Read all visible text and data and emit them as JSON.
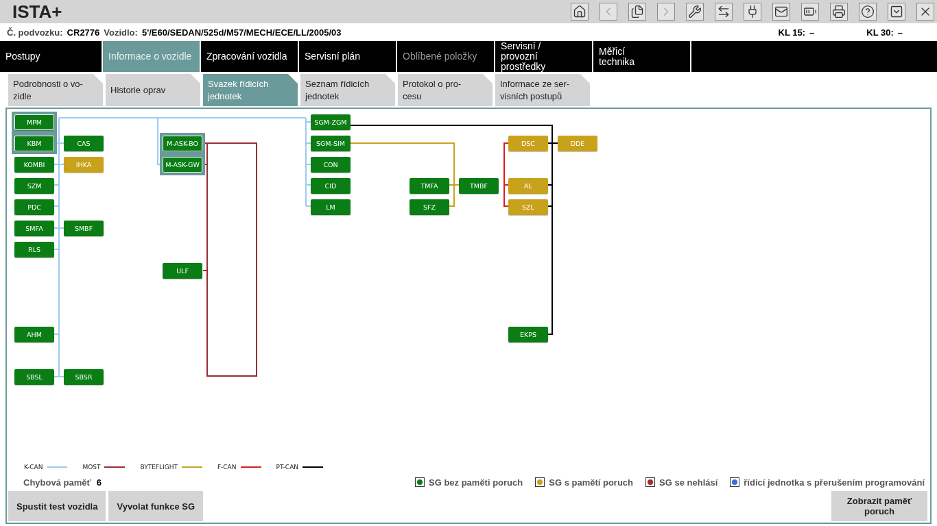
{
  "app": {
    "title": "ISTA+"
  },
  "toolbar": [
    {
      "kind": "home",
      "disabled": false
    },
    {
      "kind": "back",
      "disabled": true
    },
    {
      "kind": "documents",
      "disabled": false
    },
    {
      "kind": "forward",
      "disabled": true
    },
    {
      "kind": "wrench",
      "disabled": false
    },
    {
      "kind": "exchange",
      "disabled": false
    },
    {
      "kind": "plug",
      "disabled": false
    },
    {
      "kind": "mail",
      "disabled": false
    },
    {
      "kind": "battery",
      "disabled": false
    },
    {
      "kind": "printer",
      "disabled": false
    },
    {
      "kind": "help",
      "disabled": false
    },
    {
      "kind": "dropdown",
      "disabled": false
    },
    {
      "kind": "close",
      "disabled": false
    }
  ],
  "vehicle_info": {
    "chassis_label": "Č. podvozku:",
    "chassis_value": "CR2776",
    "vehicle_label": "Vozidlo:",
    "vehicle_value": "5'/E60/SEDAN/525d/M57/MECH/ECE/LL/2005/03",
    "kl15_label": "KL 15:",
    "kl15_value": "–",
    "kl30_label": "KL 30:",
    "kl30_value": "–"
  },
  "nav_tabs": [
    {
      "label": "Postupy",
      "selected": false,
      "disabled": false
    },
    {
      "label": "Informace o vozidle",
      "selected": true,
      "disabled": false
    },
    {
      "label": "Zpracování vozidla",
      "selected": false,
      "disabled": false
    },
    {
      "label": "Servisní plán",
      "selected": false,
      "disabled": false
    },
    {
      "label": "Oblíbené položky",
      "selected": false,
      "disabled": true
    },
    {
      "label": "Servisní /\nprovozní\nprostředky",
      "selected": false,
      "disabled": false
    },
    {
      "label": "Měřicí\ntechnika",
      "selected": false,
      "disabled": false
    }
  ],
  "sub_tabs": [
    {
      "label": "Podrobnosti o vo-\nzidle",
      "selected": false
    },
    {
      "label": "Historie oprav",
      "selected": false
    },
    {
      "label": "Svazek řídicích jednotek",
      "selected": true
    },
    {
      "label": "Seznam řídicích jednotek",
      "selected": false
    },
    {
      "label": "Protokol o pro-\ncesu",
      "selected": false
    },
    {
      "label": "Informace ze ser-\nvisních postupů",
      "selected": false
    }
  ],
  "control_units": [
    {
      "label": "MPM",
      "kind": "ok",
      "highlighted": true
    },
    {
      "label": "KBM",
      "kind": "ok",
      "highlighted": true
    },
    {
      "label": "CAS",
      "kind": "ok",
      "highlighted": false
    },
    {
      "label": "KOMBI",
      "kind": "ok",
      "highlighted": false
    },
    {
      "label": "IHKA",
      "kind": "fault",
      "highlighted": false
    },
    {
      "label": "SZM",
      "kind": "ok",
      "highlighted": false
    },
    {
      "label": "PDC",
      "kind": "ok",
      "highlighted": false
    },
    {
      "label": "SMFA",
      "kind": "ok",
      "highlighted": false
    },
    {
      "label": "SMBF",
      "kind": "ok",
      "highlighted": false
    },
    {
      "label": "RLS",
      "kind": "ok",
      "highlighted": false
    },
    {
      "label": "AHM",
      "kind": "ok",
      "highlighted": false
    },
    {
      "label": "SBSL",
      "kind": "ok",
      "highlighted": false
    },
    {
      "label": "SBSR",
      "kind": "ok",
      "highlighted": false
    },
    {
      "label": "M-ASK-BO",
      "kind": "ok",
      "highlighted": true
    },
    {
      "label": "M-ASK-GW",
      "kind": "ok",
      "highlighted": true
    },
    {
      "label": "ULF",
      "kind": "ok",
      "highlighted": false
    },
    {
      "label": "SGM-ZGM",
      "kind": "ok",
      "highlighted": false
    },
    {
      "label": "SGM-SIM",
      "kind": "ok",
      "highlighted": false
    },
    {
      "label": "CON",
      "kind": "ok",
      "highlighted": false
    },
    {
      "label": "CID",
      "kind": "ok",
      "highlighted": false
    },
    {
      "label": "LM",
      "kind": "ok",
      "highlighted": false
    },
    {
      "label": "TMFA",
      "kind": "ok",
      "highlighted": false
    },
    {
      "label": "SFZ",
      "kind": "ok",
      "highlighted": false
    },
    {
      "label": "TMBF",
      "kind": "ok",
      "highlighted": false
    },
    {
      "label": "DSC",
      "kind": "fault",
      "highlighted": false
    },
    {
      "label": "DDE",
      "kind": "fault",
      "highlighted": false
    },
    {
      "label": "AL",
      "kind": "fault",
      "highlighted": false
    },
    {
      "label": "SZL",
      "kind": "fault",
      "highlighted": false
    },
    {
      "label": "EKPS",
      "kind": "ok",
      "highlighted": false
    }
  ],
  "bus_legend": [
    {
      "label": "K-CAN",
      "color": "#9ecbee"
    },
    {
      "label": "MOST",
      "color": "#9b2c35"
    },
    {
      "label": "BYTEFLIGHT",
      "color": "#c9a21c"
    },
    {
      "label": "F-CAN",
      "color": "#d81e1e"
    },
    {
      "label": "PT-CAN",
      "color": "#000000"
    }
  ],
  "error_memory": {
    "label": "Chybová paměť",
    "value": "6"
  },
  "status_legend": [
    {
      "label": "SG bez paměti poruch",
      "color": "#0b7d15"
    },
    {
      "label": "SG s pamětí poruch",
      "color": "#c9a21c"
    },
    {
      "label": "SG se nehlásí",
      "color": "#a52a2a"
    },
    {
      "label": "řídicí jednotka s přerušením programování",
      "color": "#3a6fd8"
    }
  ],
  "buttons": [
    {
      "label": "Spustit test vozidla"
    },
    {
      "label": "Vyvolat funkce SG"
    },
    {
      "label": "Zobrazit paměť poruch"
    }
  ]
}
